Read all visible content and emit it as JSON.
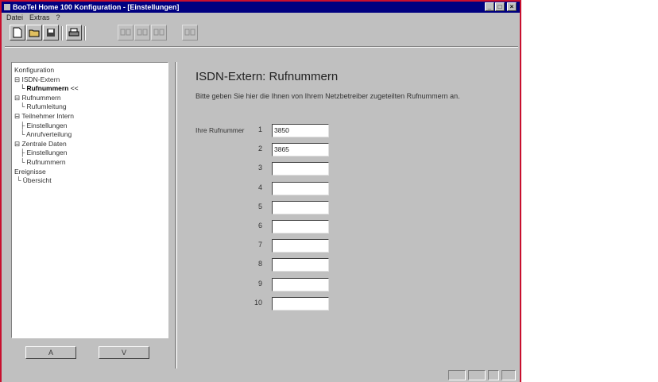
{
  "window": {
    "title": "BooTel Home 100 Konfiguration - [Einstellungen]",
    "minimize_glyph": "_",
    "restore_glyph": "□",
    "close_glyph": "×"
  },
  "menu": [
    "Datei",
    "Extras",
    "?"
  ],
  "tree": [
    {
      "label": "Konfiguration",
      "prefix": ""
    },
    {
      "label": "ISDN-Extern",
      "prefix": "⊟ "
    },
    {
      "label": "Rufnummern",
      "prefix": "   └ ",
      "selected": true,
      "suffix": " <<"
    },
    {
      "label": "Rufnummern",
      "prefix": "⊟ "
    },
    {
      "label": "Rufumleitung",
      "prefix": "   └ "
    },
    {
      "label": "Teilnehmer Intern",
      "prefix": "⊟ "
    },
    {
      "label": "Einstellungen",
      "prefix": "   ├ "
    },
    {
      "label": "Anrufverteilung",
      "prefix": "   └ "
    },
    {
      "label": "Zentrale Daten",
      "prefix": "⊟ "
    },
    {
      "label": "Einstellungen",
      "prefix": "   ├ "
    },
    {
      "label": "Rufnummern",
      "prefix": "   └ "
    },
    {
      "label": "Ereignisse",
      "prefix": ""
    },
    {
      "label": "Übersicht",
      "prefix": " └ "
    }
  ],
  "nav_buttons": {
    "prev": "A",
    "next": "V"
  },
  "page": {
    "title": "ISDN-Extern: Rufnummern",
    "description": "Bitte geben Sie hier die Ihnen von Ihrem Netzbetreiber zugeteilten Rufnummern an.",
    "field_label": "Ihre Rufnummer"
  },
  "numbers": [
    {
      "index": "1",
      "value": "3850"
    },
    {
      "index": "2",
      "value": "3865"
    },
    {
      "index": "3",
      "value": ""
    },
    {
      "index": "4",
      "value": ""
    },
    {
      "index": "5",
      "value": ""
    },
    {
      "index": "6",
      "value": ""
    },
    {
      "index": "7",
      "value": ""
    },
    {
      "index": "8",
      "value": ""
    },
    {
      "index": "9",
      "value": ""
    },
    {
      "index": "10",
      "value": ""
    }
  ]
}
